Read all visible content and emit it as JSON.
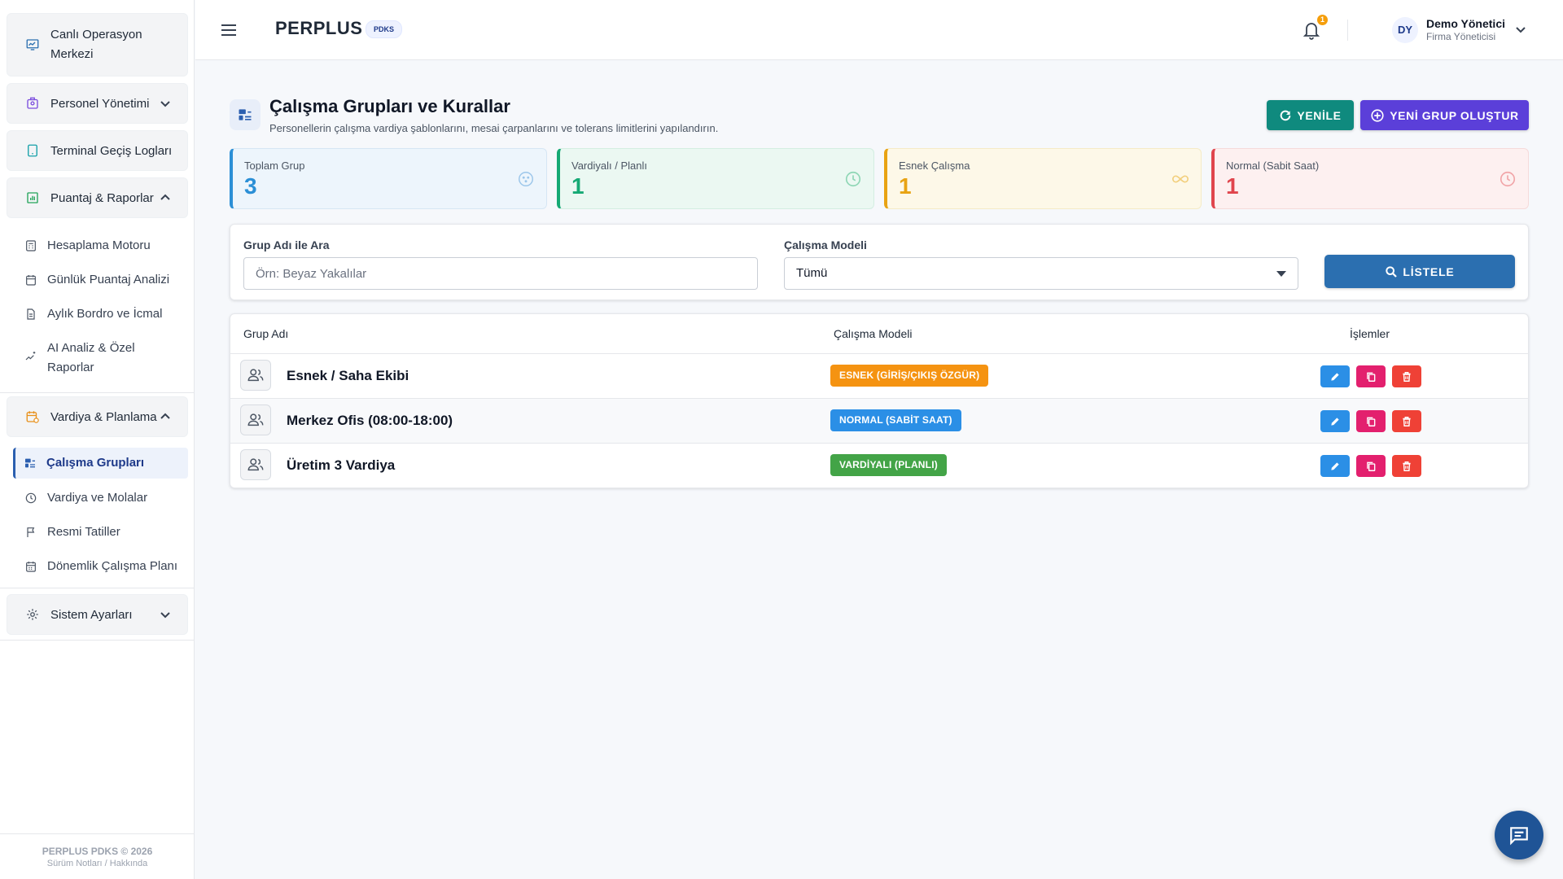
{
  "sidebar": {
    "items": [
      {
        "label": "Canlı Operasyon Merkezi"
      },
      {
        "label": "Personel Yönetimi"
      },
      {
        "label": "Terminal Geçiş Logları"
      },
      {
        "label": "Puantaj & Raporlar"
      },
      {
        "label": "Hesaplama Motoru"
      },
      {
        "label": "Günlük Puantaj Analizi"
      },
      {
        "label": "Aylık Bordro ve İcmal"
      },
      {
        "label": "AI Analiz & Özel Raporlar"
      },
      {
        "label": "Vardiya & Planlama"
      },
      {
        "label": "Çalışma Grupları"
      },
      {
        "label": "Vardiya ve Molalar"
      },
      {
        "label": "Resmi Tatiller"
      },
      {
        "label": "Dönemlik Çalışma Planı"
      },
      {
        "label": "Sistem Ayarları"
      }
    ],
    "footer_title": "PERPLUS PDKS © 2026",
    "footer_links": "Sürüm Notları / Hakkında"
  },
  "header": {
    "brand": "PERPLUS",
    "brand_tag": "PDKS",
    "notification_count": "1",
    "user_initials": "DY",
    "user_name": "Demo Yönetici",
    "user_role": "Firma Yöneticisi"
  },
  "page": {
    "title": "Çalışma Grupları ve Kurallar",
    "subtitle": "Personellerin çalışma vardiya şablonlarını, mesai çarpanlarını ve tolerans limitlerini yapılandırın.",
    "refresh_label": "YENİLE",
    "new_label": "YENİ GRUP OLUŞTUR"
  },
  "stats": [
    {
      "label": "Toplam Grup",
      "value": "3",
      "color": "#2b8fd6"
    },
    {
      "label": "Vardiyalı / Planlı",
      "value": "1",
      "color": "#16a974"
    },
    {
      "label": "Esnek Çalışma",
      "value": "1",
      "color": "#e8a313"
    },
    {
      "label": "Normal (Sabit Saat)",
      "value": "1",
      "color": "#e0454d"
    }
  ],
  "filter": {
    "search_label": "Grup Adı ile Ara",
    "search_placeholder": "Örn: Beyaz Yakalılar",
    "model_label": "Çalışma Modeli",
    "model_value": "Tümü",
    "list_label": "LİSTELE"
  },
  "table": {
    "columns": [
      "Grup Adı",
      "Çalışma Modeli",
      "İşlemler"
    ],
    "rows": [
      {
        "name": "Esnek / Saha Ekibi",
        "model": "ESNEK (GİRİŞ/ÇIKIŞ ÖZGÜR)",
        "model_color": "#f59311"
      },
      {
        "name": "Merkez Ofis (08:00-18:00)",
        "model": "NORMAL (SABİT SAAT)",
        "model_color": "#2b8fe6"
      },
      {
        "name": "Üretim 3 Vardiya",
        "model": "VARDİYALI (PLANLI)",
        "model_color": "#43a447"
      }
    ]
  }
}
